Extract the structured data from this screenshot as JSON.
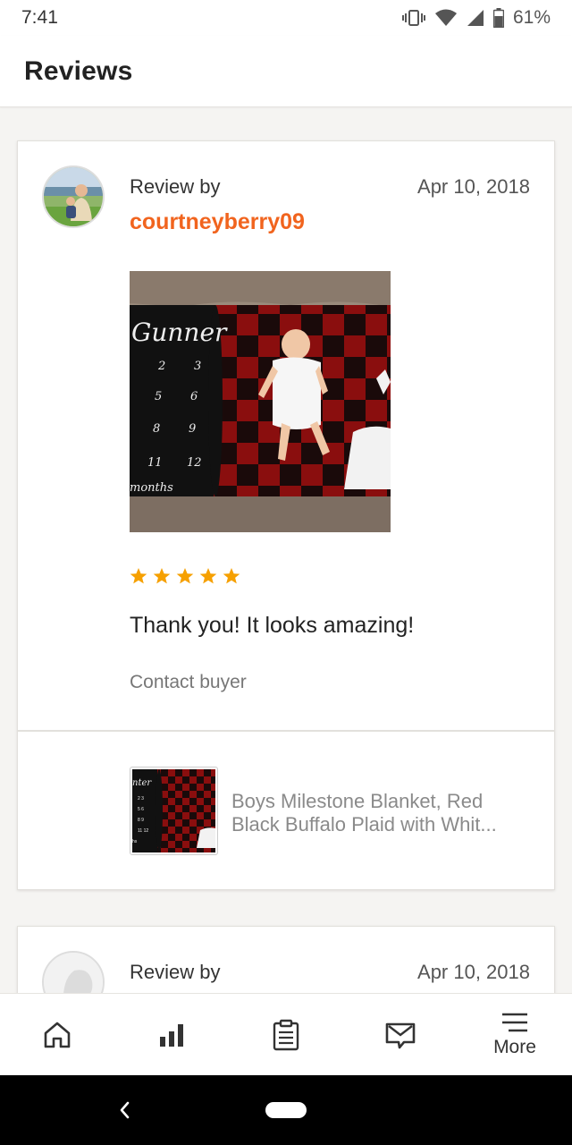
{
  "status": {
    "time": "7:41",
    "battery": "61%"
  },
  "header": {
    "title": "Reviews"
  },
  "reviews": [
    {
      "review_by_label": "Review by",
      "reviewer": "courtneyberry09",
      "date": "Apr 10, 2018",
      "rating": 5,
      "text": "Thank you! It looks amazing!",
      "contact_label": "Contact buyer",
      "listing": {
        "title_line1": "Boys Milestone Blanket, Red",
        "title_line2": "Black Buffalo Plaid with Whit..."
      }
    },
    {
      "review_by_label": "Review by",
      "date": "Apr 10, 2018"
    }
  ],
  "bottom_nav": {
    "items": [
      {
        "icon": "home-icon"
      },
      {
        "icon": "stats-icon"
      },
      {
        "icon": "orders-icon"
      },
      {
        "icon": "messages-icon"
      },
      {
        "icon": "menu-icon",
        "label": "More"
      }
    ]
  },
  "colors": {
    "accent": "#f1641e",
    "star": "#f6a000"
  }
}
